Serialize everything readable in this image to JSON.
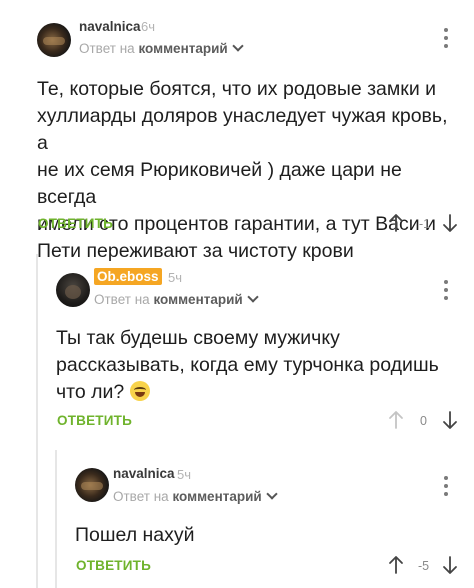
{
  "comments": [
    {
      "author": "navalnica",
      "time": "6ч",
      "reply_prefix": "Ответ на",
      "reply_target": "комментарий",
      "lines": [
        "Те, которые боятся, что их родовые замки и",
        "хуллиарды доляров унаследует чужая кровь, а",
        "не их семя Рюриковичей ) даже цари не всегда",
        "имели сто процентов гарантии, а тут Васи и",
        "Пети переживают за чистоту крови"
      ],
      "reply_label": "ОТВЕТИТЬ",
      "rating": "-1"
    },
    {
      "author": "Ob.eboss",
      "time": "5ч",
      "reply_prefix": "Ответ на",
      "reply_target": "комментарий",
      "lines": [
        "Ты так будешь своему мужичку",
        "рассказывать, когда ему турчонка родишь",
        "что ли?"
      ],
      "emoji": "grinning-sweat-emoji",
      "reply_label": "ОТВЕТИТЬ",
      "rating": "0"
    },
    {
      "author": "navalnica",
      "time": "5ч",
      "reply_prefix": "Ответ на",
      "reply_target": "комментарий",
      "lines": [
        "Пошел нахуй"
      ],
      "reply_label": "ОТВЕТИТЬ",
      "rating": "-5"
    }
  ],
  "colors": {
    "accent": "#6fb32c",
    "badge": "#f5a623",
    "thread_line": "#e6e6e6"
  },
  "icons": [
    "upvote-icon",
    "downvote-icon",
    "more-options-icon",
    "chevron-down-icon"
  ]
}
